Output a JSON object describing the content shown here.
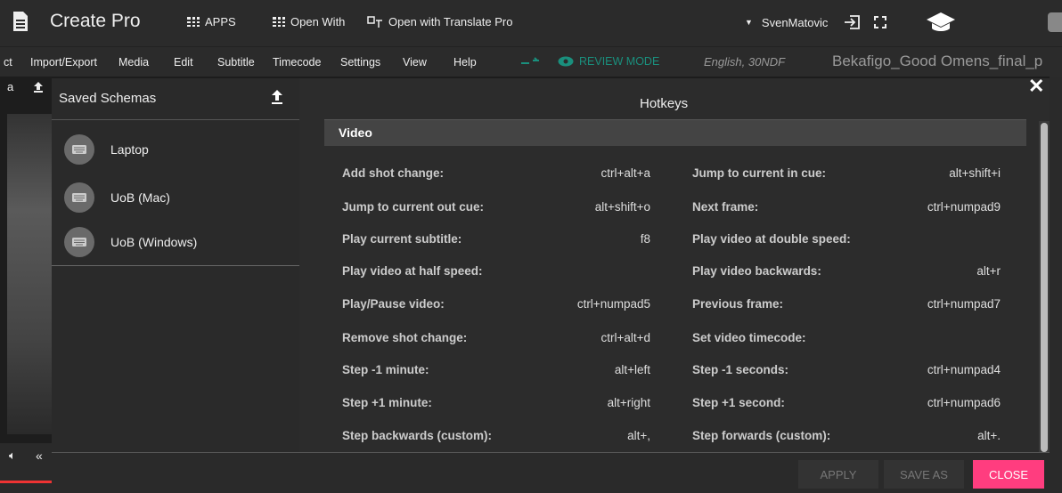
{
  "topbar": {
    "app_title": "Create Pro",
    "apps_label": "APPS",
    "open_with_label": "Open With",
    "translate_label": "Open with Translate Pro",
    "user_name": "SvenMatovic"
  },
  "menu": {
    "items": [
      "ct",
      "Import/Export",
      "Media",
      "Edit",
      "Subtitle",
      "Timecode",
      "Settings",
      "View",
      "Help"
    ],
    "review_mode": "REVIEW MODE",
    "language": "English, 30NDF",
    "filename": "Bekafigo_Good Omens_final_p"
  },
  "dialog": {
    "saved_schemas_title": "Saved Schemas",
    "schemas": [
      "Laptop",
      "UoB (Mac)",
      "UoB (Windows)"
    ],
    "hotkeys_title": "Hotkeys",
    "section": "Video",
    "left_col": [
      {
        "name": "Add shot change:",
        "key": "ctrl+alt+a"
      },
      {
        "name": "Jump to current out cue:",
        "key": "alt+shift+o"
      },
      {
        "name": "Play current subtitle:",
        "key": "f8"
      },
      {
        "name": "Play video at half speed:",
        "key": ""
      },
      {
        "name": "Play/Pause video:",
        "key": "ctrl+numpad5"
      },
      {
        "name": "Remove shot change:",
        "key": "ctrl+alt+d"
      },
      {
        "name": "Step -1 minute:",
        "key": "alt+left"
      },
      {
        "name": "Step +1 minute:",
        "key": "alt+right"
      },
      {
        "name": "Step backwards (custom):",
        "key": "alt+,"
      }
    ],
    "right_col": [
      {
        "name": "Jump to current in cue:",
        "key": "alt+shift+i"
      },
      {
        "name": "Next frame:",
        "key": "ctrl+numpad9"
      },
      {
        "name": "Play video at double speed:",
        "key": ""
      },
      {
        "name": "Play video backwards:",
        "key": "alt+r"
      },
      {
        "name": "Previous frame:",
        "key": "ctrl+numpad7"
      },
      {
        "name": "Set video timecode:",
        "key": ""
      },
      {
        "name": "Step -1 seconds:",
        "key": "ctrl+numpad4"
      },
      {
        "name": "Step +1 second:",
        "key": "ctrl+numpad6"
      },
      {
        "name": "Step forwards (custom):",
        "key": "alt+."
      }
    ],
    "buttons": {
      "apply": "APPLY",
      "save_as": "SAVE AS",
      "close": "CLOSE"
    }
  },
  "colors": {
    "accent_close": "#ff3d7f",
    "review_mode": "#1a8f7d"
  },
  "icons": [
    "document-icon",
    "apps-grid-icon",
    "translate-icon",
    "dropdown-caret-icon",
    "logout-icon",
    "fullscreen-icon",
    "graduation-cap-icon",
    "compare-arrows-icon",
    "eye-icon",
    "upload-icon",
    "keyboard-icon",
    "close-icon",
    "volume-icon",
    "rewind-icon"
  ]
}
